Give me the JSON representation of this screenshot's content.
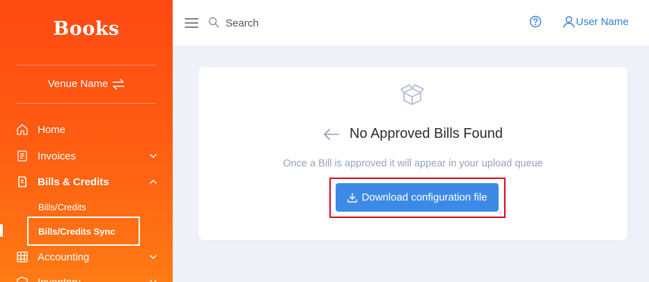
{
  "app": {
    "logo": "Books"
  },
  "sidebar": {
    "venue": "Venue Name",
    "items": [
      {
        "label": "Home"
      },
      {
        "label": "Invoices"
      },
      {
        "label": "Bills & Credits"
      },
      {
        "label": "Accounting"
      },
      {
        "label": "Inventory"
      }
    ],
    "subitems": [
      {
        "label": "Bills/Credits"
      },
      {
        "label": "Bills/Credits Sync"
      }
    ]
  },
  "header": {
    "search_placeholder": "Search",
    "user": "User Name"
  },
  "main": {
    "empty_title": "No Approved Bills Found",
    "empty_subtitle": "Once a Bill is approved it will appear in your upload queue",
    "download_label": "Download configuration file"
  },
  "colors": {
    "sidebar_start": "#ff4a12",
    "sidebar_end": "#ff7a14",
    "primary_button": "#3d8ae6",
    "link": "#2f7fd6",
    "highlight": "#e0001b"
  }
}
